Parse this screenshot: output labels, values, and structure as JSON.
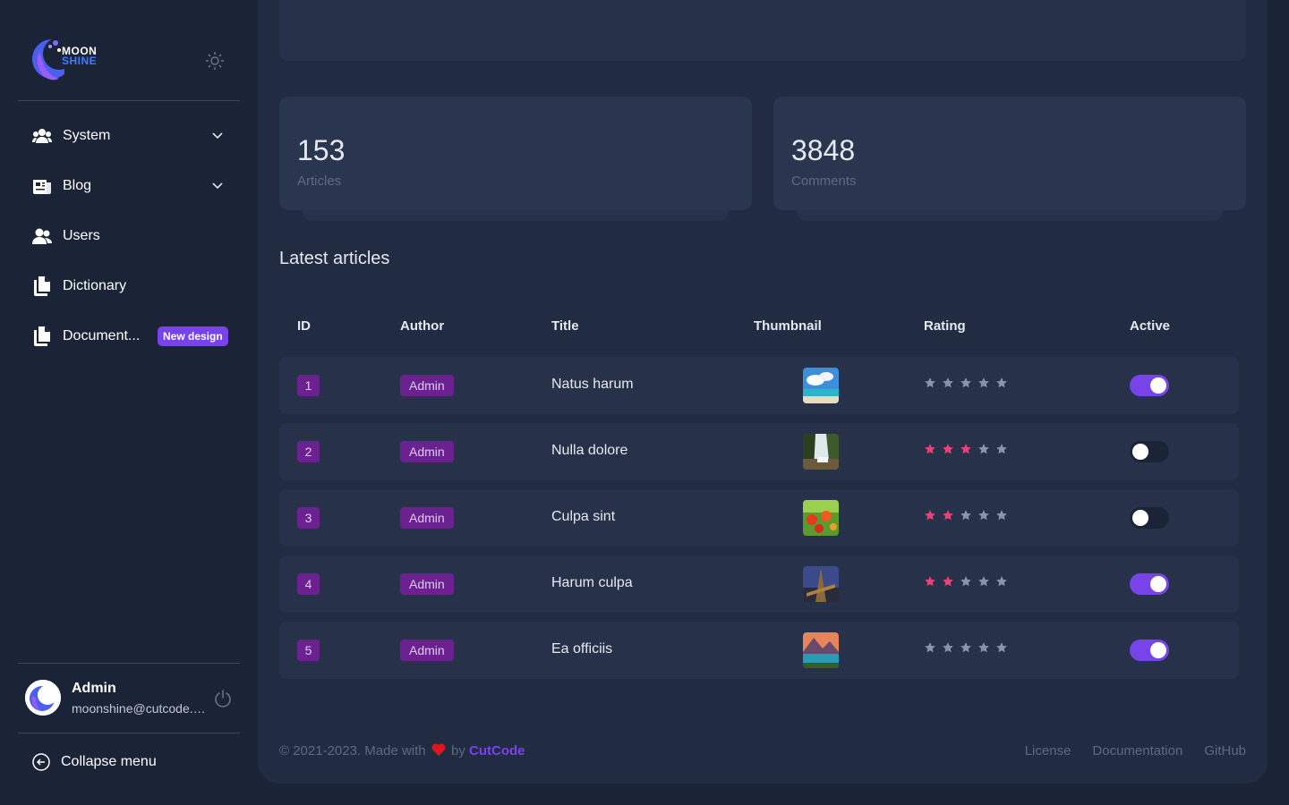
{
  "brand": {
    "line1": "MOON",
    "line2": "SHINE"
  },
  "sidebar": {
    "items": [
      {
        "label": "System"
      },
      {
        "label": "Blog"
      },
      {
        "label": "Users"
      },
      {
        "label": "Dictionary"
      },
      {
        "label": "Document...",
        "badge": "New design"
      }
    ],
    "user": {
      "name": "Admin",
      "email": "moonshine@cutcode.dev"
    },
    "collapse_label": "Collapse menu"
  },
  "stats": [
    {
      "value": "153",
      "label": "Articles"
    },
    {
      "value": "3848",
      "label": "Comments"
    }
  ],
  "section_title": "Latest articles",
  "table": {
    "columns": [
      "ID",
      "Author",
      "Title",
      "Thumbnail",
      "Rating",
      "Active"
    ],
    "rows": [
      {
        "id": "1",
        "author": "Admin",
        "title": "Natus harum",
        "rating": 0,
        "active": true
      },
      {
        "id": "2",
        "author": "Admin",
        "title": "Nulla dolore",
        "rating": 3,
        "active": false
      },
      {
        "id": "3",
        "author": "Admin",
        "title": "Culpa sint",
        "rating": 2,
        "active": false
      },
      {
        "id": "4",
        "author": "Admin",
        "title": "Harum culpa",
        "rating": 2,
        "active": true
      },
      {
        "id": "5",
        "author": "Admin",
        "title": "Ea officiis",
        "rating": 0,
        "active": true
      }
    ]
  },
  "footer": {
    "prefix": "© 2021-2023. Made with",
    "by": "by",
    "brand": "CutCode",
    "links": [
      "License",
      "Documentation",
      "GitHub"
    ]
  },
  "colors": {
    "accent": "#7843e9",
    "badge": "#6b2290",
    "star_on": "#ec4176",
    "star_off": "#8a94a6"
  }
}
